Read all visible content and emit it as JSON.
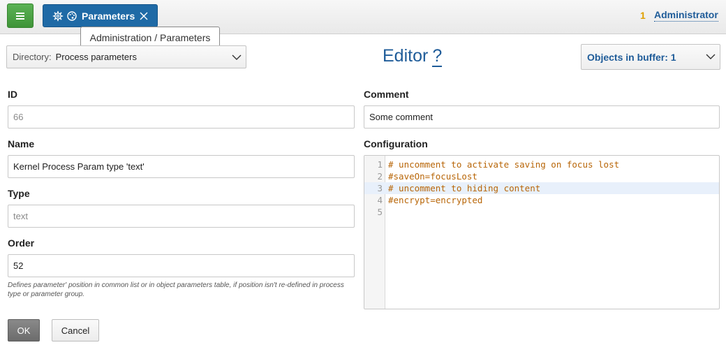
{
  "header": {
    "menu_icon": "hamburger-menu-icon",
    "tab": {
      "settings_icon": "gear-icon",
      "palette_icon": "palette-icon",
      "title": "Parameters",
      "close_icon": "close-icon"
    },
    "tooltip": "Administration / Parameters",
    "notifications_count": "1",
    "user": "Administrator"
  },
  "toolbar": {
    "directory_label": "Directory:",
    "directory_value": "Process parameters",
    "editor_title": "Editor",
    "help_label": "?",
    "buffer_label": "Objects in buffer: 1"
  },
  "form": {
    "id": {
      "label": "ID",
      "placeholder": "66"
    },
    "name": {
      "label": "Name",
      "value": "Kernel Process Param type 'text'"
    },
    "type": {
      "label": "Type",
      "placeholder": "text"
    },
    "order": {
      "label": "Order",
      "value": "52",
      "hint": "Defines parameter' position in common list or in object parameters table, if position isn't re-defined in process type or parameter group."
    },
    "comment": {
      "label": "Comment",
      "value": "Some comment"
    },
    "configuration": {
      "label": "Configuration",
      "lines": [
        {
          "num": "1",
          "text": "# uncomment to activate saving on focus lost"
        },
        {
          "num": "2",
          "text": "#saveOn=focusLost"
        },
        {
          "num": "3",
          "text": "# uncomment to hiding content"
        },
        {
          "num": "4",
          "text": "#encrypt=encrypted"
        },
        {
          "num": "5",
          "text": ""
        }
      ],
      "active_line": 3
    }
  },
  "actions": {
    "ok": "OK",
    "cancel": "Cancel"
  },
  "colors": {
    "accent": "#1f5c99",
    "menu_green": "#4ca446",
    "tab_blue": "#1f6aa6",
    "code_text": "#b86608",
    "notification": "#e0a000"
  }
}
